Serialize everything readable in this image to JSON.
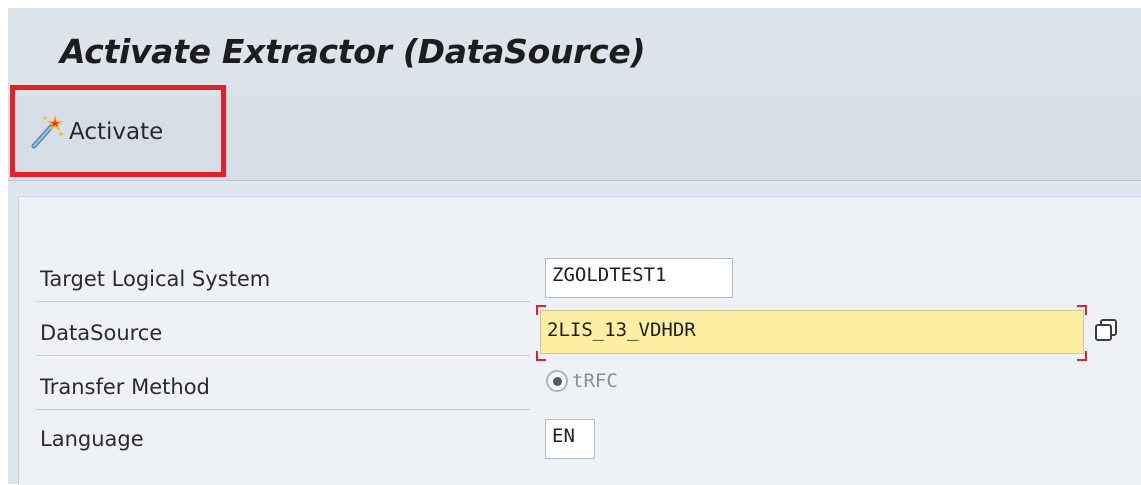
{
  "window": {
    "title": "Activate Extractor (DataSource)"
  },
  "toolbar": {
    "activate_label": "Activate",
    "activate_icon": "magic-wand-icon",
    "highlight_color": "#e32027"
  },
  "form": {
    "target_logical_system": {
      "label": "Target Logical System",
      "value": "ZGOLDTEST1"
    },
    "datasource": {
      "label": "DataSource",
      "value": "2LIS_13_VDHDR",
      "required": true,
      "value_help_icon": "value-help-icon"
    },
    "transfer_method": {
      "label": "Transfer Method",
      "option": "tRFC",
      "selected": true,
      "enabled": false
    },
    "language": {
      "label": "Language",
      "value": "EN"
    }
  },
  "colors": {
    "required_field_bg": "#fcefa1",
    "required_marker": "#e32027",
    "panel_bg": "#eef2f6",
    "toolbar_bg": "#d5dde6"
  }
}
